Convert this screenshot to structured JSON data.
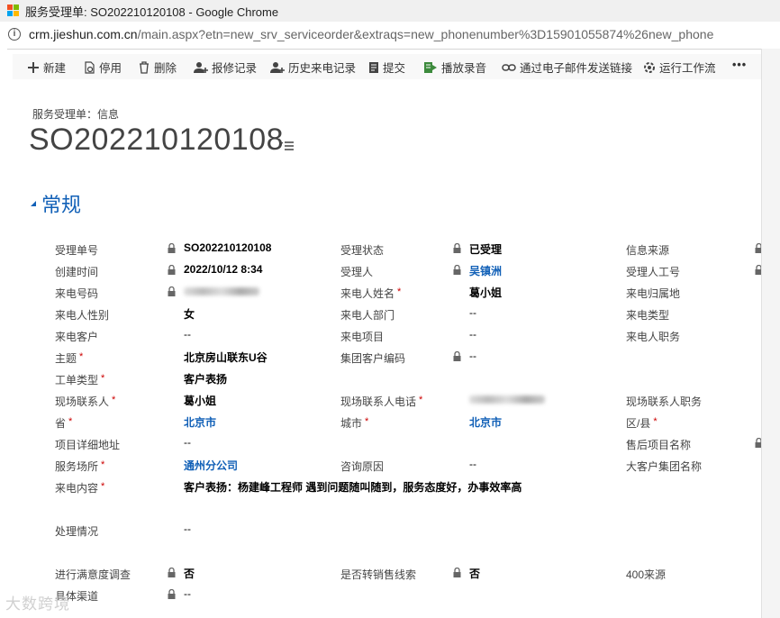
{
  "window": {
    "title": "服务受理单: SO202210120108 - Google Chrome"
  },
  "address": {
    "host": "crm.jieshun.com.cn",
    "path": "/main.aspx?etn=new_srv_serviceorder&extraqs=new_phonenumber%3D15901055874%26new_phone"
  },
  "commands": [
    {
      "label": "新建",
      "icon": "plus-icon"
    },
    {
      "label": "停用",
      "icon": "deactivate-icon"
    },
    {
      "label": "删除",
      "icon": "trash-icon"
    },
    {
      "label": "报修记录",
      "icon": "user-add-icon"
    },
    {
      "label": "历史来电记录",
      "icon": "user-add-icon"
    },
    {
      "label": "提交",
      "icon": "submit-icon"
    },
    {
      "label": "播放录音",
      "icon": "play-record-icon"
    },
    {
      "label": "通过电子邮件发送链接",
      "icon": "link-icon"
    },
    {
      "label": "运行工作流",
      "icon": "workflow-icon"
    },
    {
      "label": "•••",
      "icon": "more-icon"
    }
  ],
  "header": {
    "breadcrumb": "服务受理单：信息",
    "title": "SO202210120108"
  },
  "section": {
    "title": "常规"
  },
  "fields": {
    "c1": [
      {
        "label": "受理单号",
        "value": "SO202210120108",
        "lock": true
      },
      {
        "label": "创建时间",
        "value": "2022/10/12   8:34",
        "lock": true
      },
      {
        "label": "来电号码",
        "value": "",
        "lock": true,
        "blurred": true
      },
      {
        "label": "来电人性别",
        "value": "女"
      },
      {
        "label": "来电客户",
        "value": "--",
        "plain": true
      },
      {
        "label": "主题",
        "value": "北京房山联东U谷",
        "required": true
      },
      {
        "label": "工单类型",
        "value": "客户表扬",
        "required": true
      },
      {
        "label": "现场联系人",
        "value": "葛小姐",
        "required": true
      },
      {
        "label": "省",
        "value": "北京市",
        "required": true,
        "link": true
      },
      {
        "label": "项目详细地址",
        "value": "--",
        "plain": true
      },
      {
        "label": "服务场所",
        "value": "通州分公司",
        "required": true,
        "link": true
      },
      {
        "label": "来电内容",
        "value": "客户表扬：杨建峰工程师 遇到问题随叫随到，服务态度好，办事效率高",
        "required": true
      },
      {
        "label": "处理情况",
        "value": "--",
        "plain": true
      },
      {
        "label": "进行满意度调查",
        "value": "否",
        "lock": true
      },
      {
        "label": "具体渠道",
        "value": "--",
        "lock": true,
        "plain": true
      }
    ],
    "c2": [
      {
        "label": "受理状态",
        "value": "已受理",
        "lock": true
      },
      {
        "label": "受理人",
        "value": "吴镇洲",
        "lock": true,
        "link": true
      },
      {
        "label": "来电人姓名",
        "value": "葛小姐",
        "required": true
      },
      {
        "label": "来电人部门",
        "value": "--",
        "plain": true
      },
      {
        "label": "来电项目",
        "value": "--",
        "plain": true
      },
      {
        "label": "集团客户编码",
        "value": "--",
        "lock": true,
        "plain": true
      },
      {
        "label": "现场联系人电话",
        "value": "",
        "required": true,
        "blurred": true
      },
      {
        "label": "城市",
        "value": "北京市",
        "required": true,
        "link": true
      },
      {
        "label": "咨询原因",
        "value": "--",
        "plain": true
      },
      {
        "label": "是否转销售线索",
        "value": "否",
        "lock": true
      }
    ],
    "c3": [
      {
        "label": "信息来源"
      },
      {
        "label": "受理人工号"
      },
      {
        "label": "来电归属地"
      },
      {
        "label": "来电类型"
      },
      {
        "label": "来电人职务"
      },
      {
        "label": "现场联系人职务"
      },
      {
        "label": "区/县",
        "required": true
      },
      {
        "label": "售后项目名称"
      },
      {
        "label": "大客户集团名称"
      },
      {
        "label": "400来源"
      }
    ]
  },
  "watermark": "大数跨境"
}
